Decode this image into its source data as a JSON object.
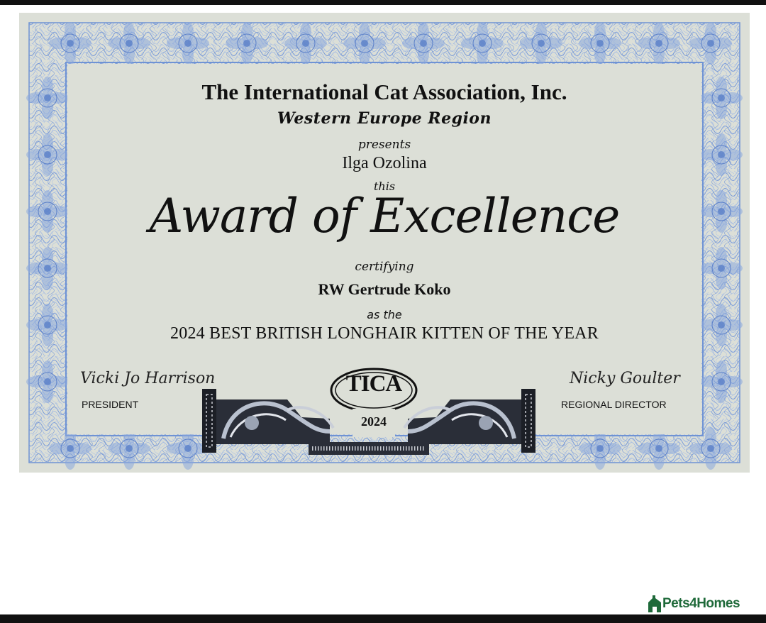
{
  "certificate": {
    "organization": "The International Cat Association, Inc.",
    "region": "Western Europe Region",
    "presents": "presents",
    "recipient": "Ilga Ozolina",
    "this": "this",
    "award": "Award of Excellence",
    "certifying": "certifying",
    "cat_name": "RW Gertrude Koko",
    "as_the": "as the",
    "award_title": "2024 BEST BRITISH LONGHAIR KITTEN OF THE YEAR",
    "left_signature": "Vicki Jo Harrison",
    "left_role": "PRESIDENT",
    "right_signature": "Nicky Goulter",
    "right_role": "REGIONAL DIRECTOR",
    "seal_text": "TICA",
    "seal_year": "2024"
  },
  "watermark": {
    "label": "Pets4Homes",
    "color": "#1f6a3a"
  },
  "colors": {
    "border_blue": "#6f93d4",
    "paper": "#dcdfd7"
  }
}
